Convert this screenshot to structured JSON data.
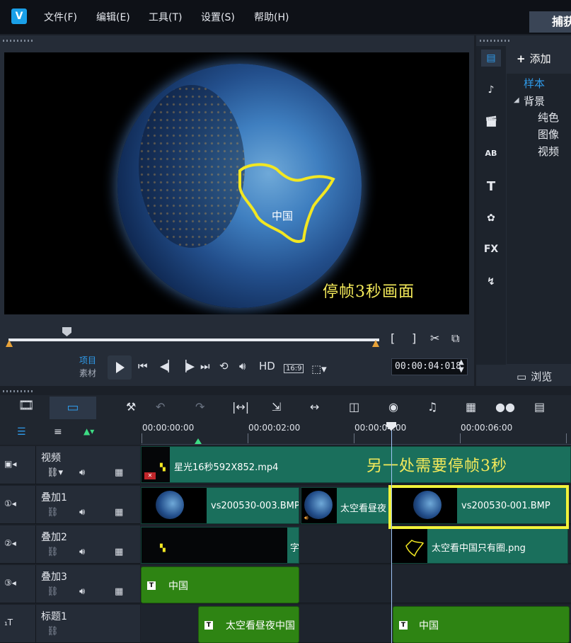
{
  "app": {
    "logo_text": "V"
  },
  "menu": {
    "file": "文件(F)",
    "edit": "编辑(E)",
    "tools": "工具(T)",
    "settings": "设置(S)",
    "help": "帮助(H)"
  },
  "top_tab": {
    "label": "捕获"
  },
  "preview": {
    "overlay_label": "中国",
    "caption": "停帧3秒画面",
    "mode_project": "项目",
    "mode_clip": "素材",
    "hd_label": "HD",
    "aspect_label": "16:9",
    "timecode": "00:00:04:018",
    "mark_in": "[",
    "mark_out": "]"
  },
  "library": {
    "add_label": "添加",
    "tree": {
      "sample": "样本",
      "background": "背景",
      "solid_color": "纯色",
      "image": "图像",
      "video": "视频"
    },
    "browse_label": "浏览",
    "icons": [
      "media-icon",
      "audio-icon",
      "instant-project-icon",
      "transition-icon",
      "title-icon",
      "graphic-icon",
      "filter-icon",
      "path-icon"
    ]
  },
  "ruler": {
    "ticks": [
      "00:00:00:00",
      "00:00:02:00",
      "00:00:04:00",
      "00:00:06:00"
    ]
  },
  "tracks": {
    "video": {
      "name": "视频"
    },
    "overlay1": {
      "name": "叠加1"
    },
    "overlay2": {
      "name": "叠加2"
    },
    "overlay3": {
      "name": "叠加3"
    },
    "title1": {
      "name": "标题1"
    }
  },
  "clips": {
    "video_main": "星光16秒592X852.mp4",
    "ov1_a": "vs200530-003.BMP",
    "ov1_b": "太空看昼夜",
    "ov1_c": "vs200530-001.BMP",
    "ov2_a": "字",
    "ov2_b": "太空看中国只有圈.png",
    "ov3_a": "中国",
    "title_a": "太空看昼夜中国",
    "title_b": "中国"
  },
  "annotation": {
    "another_freeze": "另一处需要停帧3秒"
  },
  "colors": {
    "accent": "#2f9bea",
    "clip_teal": "#1a6f5c",
    "title_green": "#2e8413",
    "highlight": "#f2f23a",
    "caption_yellow": "#f4ea5a"
  }
}
